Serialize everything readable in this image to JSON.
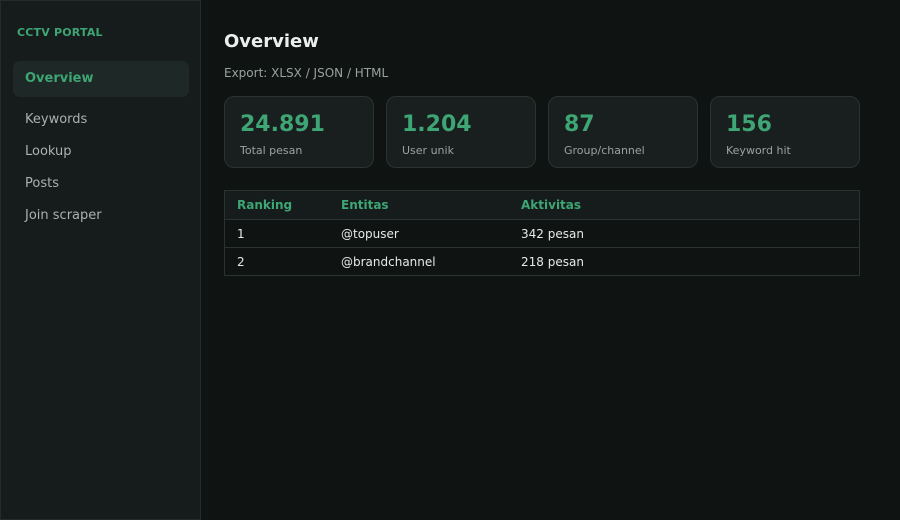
{
  "sidebar": {
    "brand": "CCTV PORTAL",
    "items": [
      {
        "label": "Overview",
        "active": true
      },
      {
        "label": "Keywords",
        "active": false
      },
      {
        "label": "Lookup",
        "active": false
      },
      {
        "label": "Posts",
        "active": false
      },
      {
        "label": "Join scraper",
        "active": false
      }
    ]
  },
  "main": {
    "title": "Overview",
    "export_text": "Export: XLSX / JSON / HTML",
    "stats": [
      {
        "value": "24.891",
        "label": "Total pesan"
      },
      {
        "value": "1.204",
        "label": "User unik"
      },
      {
        "value": "87",
        "label": "Group/channel"
      },
      {
        "value": "156",
        "label": "Keyword hit"
      }
    ],
    "table": {
      "columns": [
        "Ranking",
        "Entitas",
        "Aktivitas"
      ],
      "rows": [
        [
          "1",
          "@topuser",
          "342 pesan"
        ],
        [
          "2",
          "@brandchannel",
          "218 pesan"
        ]
      ]
    }
  },
  "colors": {
    "accent": "#3ea574",
    "background": "#0f1312",
    "sidebar": "#161c1b",
    "card": "#191f1e"
  }
}
